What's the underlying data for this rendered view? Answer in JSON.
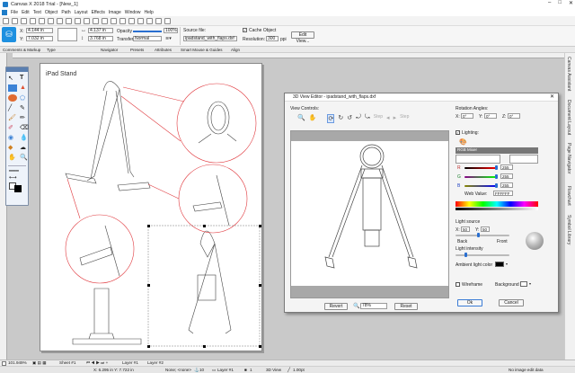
{
  "window": {
    "title": "Canvas X 2018 Trial - [New_1]"
  },
  "menu": [
    "File",
    "Edit",
    "Text",
    "Object",
    "Path",
    "Layout",
    "Effects",
    "Image",
    "Window",
    "Help"
  ],
  "props": {
    "x_label": "X:",
    "x_value": "4.144 in",
    "y_label": "Y:",
    "y_value": "7.032 in",
    "w_value": "4.137 in",
    "h_value": "3.768 in",
    "opacity_label": "Opacity",
    "opacity_value": "100%",
    "transfer_label": "Transfer",
    "transfer_value": "Normal",
    "source_label": "Source file:",
    "source_value": "ipadstand_with_flaps.dxf",
    "cache_label": "Cache Object",
    "resolution_label": "Resolution:",
    "resolution_value": "300",
    "resolution_unit": "ppi",
    "edit_view_label": "Edit View..."
  },
  "tabs": [
    "Comments & Markup",
    "Type",
    "Navigator",
    "Presets",
    "Attributes",
    "Smart Mouse & Guides",
    "Align"
  ],
  "document": {
    "heading": "iPad Stand"
  },
  "right_tabs": [
    "Canvas Assistant",
    "Document Layout",
    "Page Navigator",
    "Flowchart",
    "Symbol Library"
  ],
  "status": {
    "zoom": "101.949%",
    "sheet": "Sheet #1",
    "layer1": "Layer #1",
    "layer2": "Layer #2",
    "coords": "X: 6.295 in Y: 7.722 in",
    "snap": "None; <none>",
    "z": "10",
    "layer": "Layer #1",
    "count": "1",
    "mode": "3D View",
    "line": "1.00pt",
    "info": "No image edit data"
  },
  "dialog": {
    "title": "3D View Editor - ipadstand_with_flaps.dxf",
    "view_controls_label": "View Controls:",
    "step_label": "Step",
    "step_label2": "Step",
    "rotation_label": "Rotation Angles:",
    "rot_x": "0°",
    "rot_y": "0°",
    "rot_z": "0°",
    "lighting_label": "Lighting:",
    "rgb_label": "RGB Mixer",
    "r_label": "R",
    "r_value": "255",
    "g_label": "G",
    "g_value": "255",
    "b_label": "B",
    "b_value": "255",
    "web_label": "Web Value:",
    "web_value": "FFFFFF",
    "light_source_label": "Light source",
    "ls_x": "50",
    "ls_y": "50",
    "back_label": "Back",
    "front_label": "Front",
    "intensity_label": "Light intensity",
    "ambient_label": "Ambient light color",
    "wireframe_label": "Wireframe",
    "background_label": "Background",
    "revert_label": "Revert",
    "zoom_value": "78%",
    "reset_label": "Reset",
    "ok_label": "Ok",
    "cancel_label": "Cancel"
  },
  "colors": {
    "accent": "#1e90e0",
    "callout": "#e0393e",
    "toolbox": "#eef3fa"
  }
}
